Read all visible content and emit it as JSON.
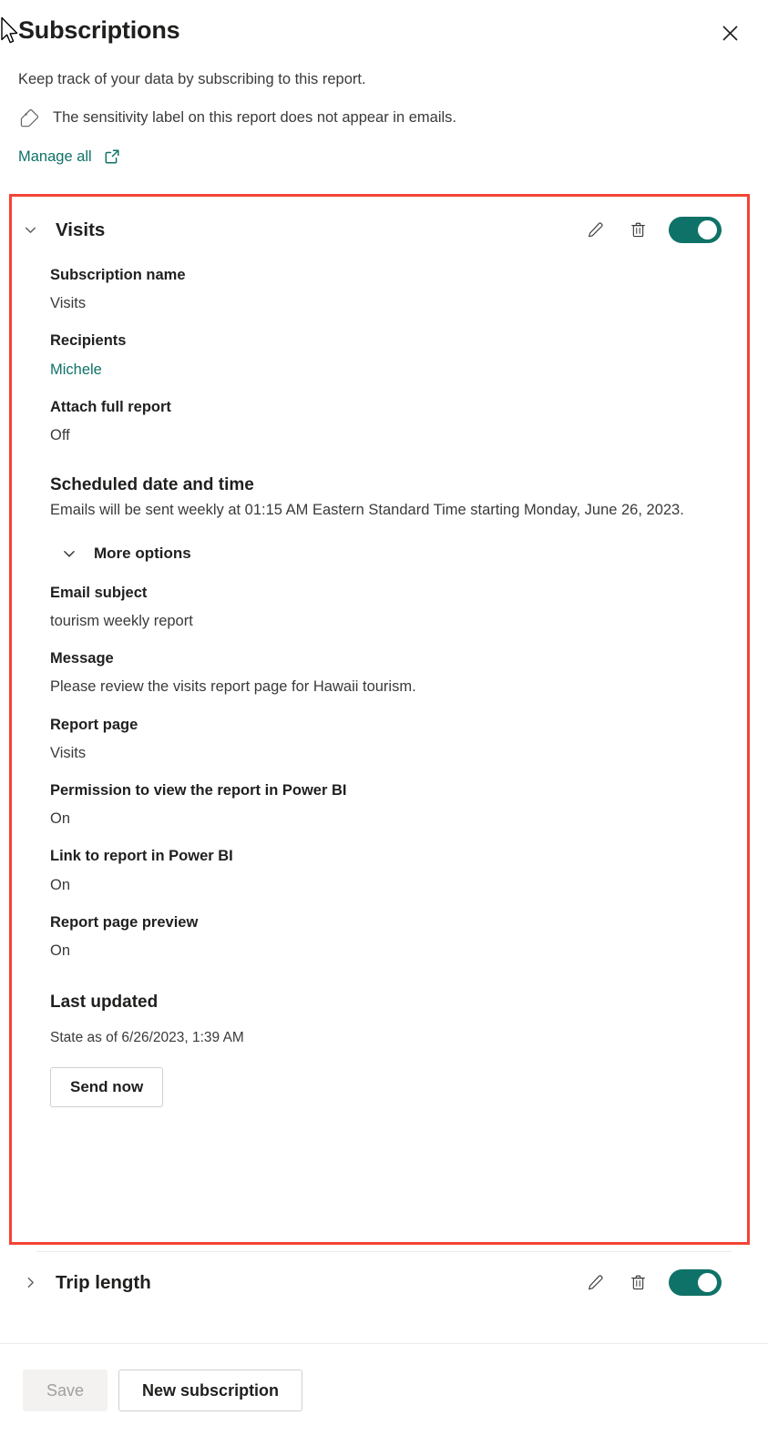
{
  "panel": {
    "title": "Subscriptions",
    "close_label": "Close",
    "subtitle": "Keep track of your data by subscribing to this report.",
    "sensitivity_notice": "The sensitivity label on this report does not appear in emails.",
    "manage_all_label": "Manage all"
  },
  "colors": {
    "accent_teal": "#0f7268",
    "highlight_red": "#f44336",
    "toggle_on": "#0f7268",
    "text_primary": "#201f1e",
    "text_secondary": "#3b3a39",
    "disabled_text": "#a19f9d"
  },
  "subscriptions": [
    {
      "name": "Visits",
      "expanded": true,
      "toggle_state": "on",
      "edit_label": "Edit",
      "delete_label": "Delete",
      "fields": [
        {
          "label": "Subscription name",
          "value": "Visits"
        },
        {
          "label": "Recipients",
          "value": "Michele",
          "is_link": true
        },
        {
          "label": "Attach full report",
          "value": "Off"
        },
        {
          "label": "Scheduled date and time",
          "value": "Emails will be sent weekly at 01:15 AM Eastern Standard Time starting Monday, June 26, 2023."
        }
      ],
      "more_options_label": "More options",
      "more_options_expanded": true,
      "more_fields": [
        {
          "label": "Email subject",
          "value": "tourism weekly report"
        },
        {
          "label": "Message",
          "value": "Please review the visits report page for Hawaii tourism."
        },
        {
          "label": "Report page",
          "value": "Visits"
        },
        {
          "label": "Permission to view the report in Power BI",
          "value": "On"
        },
        {
          "label": "Link to report in Power BI",
          "value": "On"
        },
        {
          "label": "Report page preview",
          "value": "On"
        }
      ],
      "last_updated_label": "Last updated",
      "last_updated_value": "State as of 6/26/2023, 1:39 AM",
      "send_now_label": "Send now"
    },
    {
      "name": "Trip length",
      "expanded": false,
      "toggle_state": "on",
      "edit_label": "Edit",
      "delete_label": "Delete"
    }
  ],
  "footer": {
    "save_label": "Save",
    "save_disabled": true,
    "new_subscription_label": "New subscription"
  }
}
